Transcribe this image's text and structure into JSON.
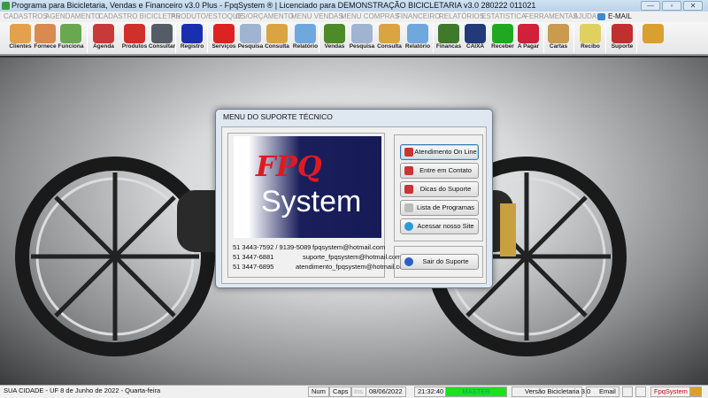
{
  "title": "Programa para Bicicletaria, Vendas e Financeiro v3.0 Plus - FpqSystem ® | Licenciado para  DEMONSTRAÇÃO BICICLETARIA v3.0 280222 011021",
  "menu": [
    "CADASTROS",
    "AGENDAMENTO",
    "CADASTRO BICICLETAS",
    "PRODUTO/ESTOQUE",
    "OS/ORÇAMENTO",
    "MENU VENDAS",
    "MENU COMPRAS",
    "FINANCEIRO",
    "RELATÓRIOS",
    "ESTATISTICA",
    "FERRAMENTAS",
    "AJUDA"
  ],
  "menu_email": "E-MAIL",
  "toolbar": [
    {
      "label": "Clientes",
      "color": "#e4a04a"
    },
    {
      "label": "Fornece",
      "color": "#d98a50"
    },
    {
      "label": "Funciona",
      "color": "#6aa84f"
    },
    {
      "label": "Agenda",
      "color": "#c83a3a"
    },
    {
      "label": "Produtos",
      "color": "#d0302a"
    },
    {
      "label": "Consultar",
      "color": "#555c66"
    },
    {
      "label": "Registro",
      "color": "#1a2fb0"
    },
    {
      "label": "Serviços",
      "color": "#d22"
    },
    {
      "label": "Pesquisa",
      "color": "#9fb4d0"
    },
    {
      "label": "Consulta",
      "color": "#d9a441"
    },
    {
      "label": "Relatório",
      "color": "#6fa8dc"
    },
    {
      "label": "Vendas",
      "color": "#4c8a2a"
    },
    {
      "label": "Pesquisa",
      "color": "#9fb4d0"
    },
    {
      "label": "Consulta",
      "color": "#d9a441"
    },
    {
      "label": "Relatório",
      "color": "#6fa8dc"
    },
    {
      "label": "Financas",
      "color": "#3f7a2a"
    },
    {
      "label": "CAIXA",
      "color": "#233a7a"
    },
    {
      "label": "Receber",
      "color": "#21a821"
    },
    {
      "label": "A Pagar",
      "color": "#d0203a"
    },
    {
      "label": "Cartas",
      "color": "#c99a50"
    },
    {
      "label": "Recibo",
      "color": "#e0d060"
    },
    {
      "label": "Suporte",
      "color": "#c03030"
    },
    {
      "label": "",
      "color": "#d9a030"
    }
  ],
  "dialog": {
    "title": "MENU DO SUPORTE TÉCNICO",
    "logo_text": [
      "FPQ",
      "System"
    ],
    "contacts": [
      {
        "phone": "51 3443-7592 / 9139-5089",
        "email": "fpqsystem@hotmail.com"
      },
      {
        "phone": "51 3447-6881",
        "email": "suporte_fpqsystem@hotmail.com"
      },
      {
        "phone": "51 3447-6895",
        "email": "atendimento_fpqsystem@hotmail.com"
      }
    ],
    "buttons": [
      "Atendimento On Line",
      "Entre em Contato",
      "Dicas do Suporte",
      "Lista de Programas",
      "Acessar nosso Site"
    ],
    "exit_button": "Sair do Suporte"
  },
  "status": {
    "city": "SUA CIDADE - UF  8 de Junho de 2022 - Quarta-feira",
    "num": "Num",
    "caps": "Caps",
    "ins": "Ins",
    "date": "08/06/2022",
    "time": "21:32:40",
    "user": "MASTER",
    "version": "Versão Bicicletaria 3.0",
    "email": "Email",
    "brand": "FpqSystem"
  },
  "colors": {
    "master": "#22dd22",
    "brand": "#d01010"
  }
}
